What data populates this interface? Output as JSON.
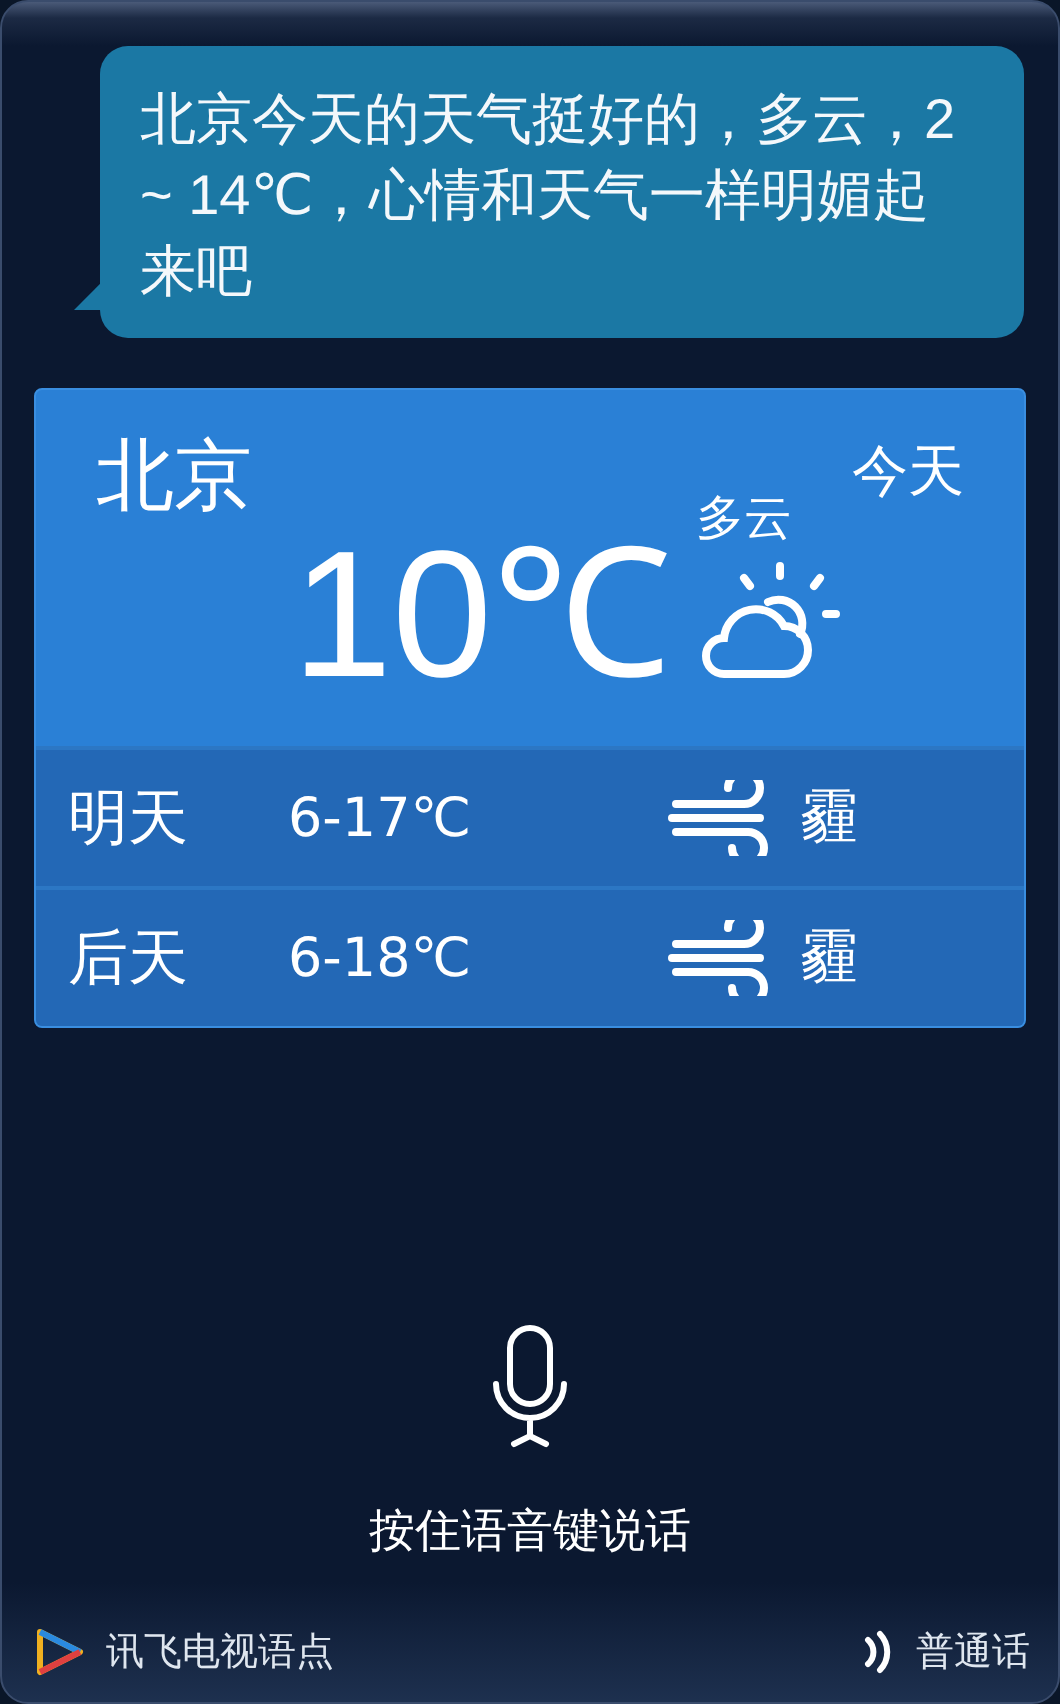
{
  "message": {
    "text": "北京今天的天气挺好的，多云，2 ~ 14℃，心情和天气一样明媚起来吧"
  },
  "weather": {
    "city": "北京",
    "day": "今天",
    "temperature": "10℃",
    "condition": "多云",
    "forecast": [
      {
        "day": "明天",
        "range": "6-17℃",
        "condition": "霾"
      },
      {
        "day": "后天",
        "range": "6-18℃",
        "condition": "霾"
      }
    ]
  },
  "voice": {
    "hint": "按住语音键说话"
  },
  "footer": {
    "app": "讯飞电视语点",
    "language": "普通话"
  }
}
